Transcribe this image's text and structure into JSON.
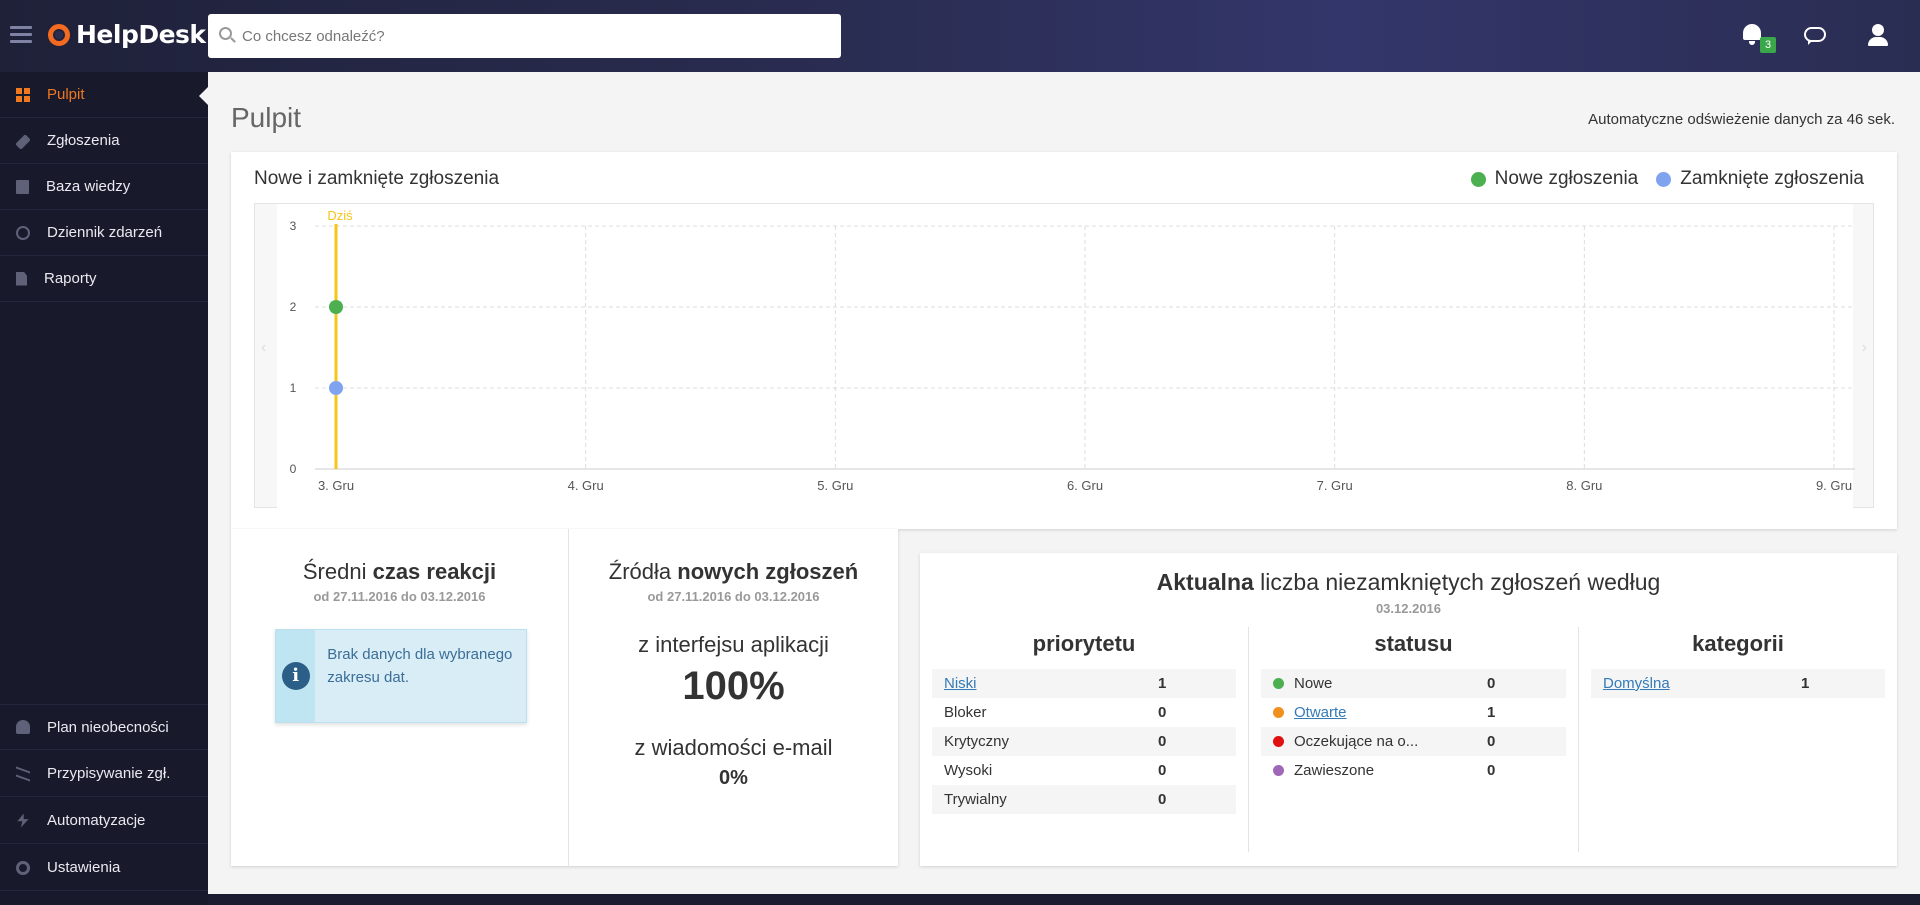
{
  "app": {
    "name": "HelpDesk"
  },
  "search": {
    "placeholder": "Co chcesz odnaleźć?"
  },
  "header": {
    "notifications_count": "3"
  },
  "sidebar": {
    "items": [
      {
        "label": "Pulpit",
        "icon": "dashboard-icon",
        "active": true
      },
      {
        "label": "Zgłoszenia",
        "icon": "tag-icon"
      },
      {
        "label": "Baza wiedzy",
        "icon": "book-icon"
      },
      {
        "label": "Dziennik zdarzeń",
        "icon": "clock-icon"
      },
      {
        "label": "Raporty",
        "icon": "document-icon"
      }
    ],
    "bottom_items": [
      {
        "label": "Plan nieobecności",
        "icon": "user-absence-icon"
      },
      {
        "label": "Przypisywanie zgł.",
        "icon": "shuffle-icon"
      },
      {
        "label": "Automatyzacje",
        "icon": "bolt-icon"
      },
      {
        "label": "Ustawienia",
        "icon": "gears-icon"
      }
    ]
  },
  "page": {
    "title": "Pulpit",
    "refresh_text": "Automatyczne odświeżenie danych za 46 sek."
  },
  "chart_card": {
    "title": "Nowe i zamknięte zgłoszenia",
    "legend": [
      {
        "label": "Nowe zgłoszenia",
        "color": "#4caf50"
      },
      {
        "label": "Zamknięte zgłoszenia",
        "color": "#7fa3ef"
      }
    ]
  },
  "chart_data": {
    "type": "line",
    "categories": [
      "3. Gru",
      "4. Gru",
      "5. Gru",
      "6. Gru",
      "7. Gru",
      "8. Gru",
      "9. Gru"
    ],
    "series": [
      {
        "name": "Nowe zgłoszenia",
        "color": "#4caf50",
        "values": [
          2,
          null,
          null,
          null,
          null,
          null,
          null
        ]
      },
      {
        "name": "Zamknięte zgłoszenia",
        "color": "#7fa3ef",
        "values": [
          1,
          null,
          null,
          null,
          null,
          null,
          null
        ]
      }
    ],
    "yticks": [
      "0",
      "1",
      "2",
      "3"
    ],
    "ylim": [
      0,
      3
    ],
    "today_marker": {
      "label": "Dziś",
      "category": "3. Gru",
      "color": "#f5c518"
    },
    "grid": true,
    "legend_position": "top-right"
  },
  "reaction": {
    "title_normal": "Średni ",
    "title_bold": "czas reakcji",
    "range": "od 27.11.2016 do 03.12.2016",
    "info": "Brak danych dla wybranego zakresu dat."
  },
  "sources": {
    "title_normal": "Źródła ",
    "title_bold": "nowych zgłoszeń",
    "range": "od 27.11.2016 do 03.12.2016",
    "app_label": "z interfejsu aplikacji",
    "app_value": "100%",
    "email_label": "z wiadomości e-mail",
    "email_value": "0%"
  },
  "open_tickets": {
    "title_bold": "Aktualna",
    "title_rest": " liczba niezamkniętych zgłoszeń według",
    "date": "03.12.2016",
    "priority": {
      "header": "priorytetu",
      "rows": [
        {
          "label": "Niski",
          "value": "1",
          "link": true
        },
        {
          "label": "Bloker",
          "value": "0"
        },
        {
          "label": "Krytyczny",
          "value": "0"
        },
        {
          "label": "Wysoki",
          "value": "0"
        },
        {
          "label": "Trywialny",
          "value": "0"
        }
      ]
    },
    "status": {
      "header": "statusu",
      "rows": [
        {
          "label": "Nowe",
          "value": "0",
          "color": "#4caf50"
        },
        {
          "label": "Otwarte",
          "value": "1",
          "color": "#f0901e",
          "link": true
        },
        {
          "label": "Oczekujące na o...",
          "value": "0",
          "color": "#e01010"
        },
        {
          "label": "Zawieszone",
          "value": "0",
          "color": "#a066b8"
        }
      ]
    },
    "category": {
      "header": "kategorii",
      "rows": [
        {
          "label": "Domyślna",
          "value": "1",
          "link": true
        }
      ]
    }
  }
}
